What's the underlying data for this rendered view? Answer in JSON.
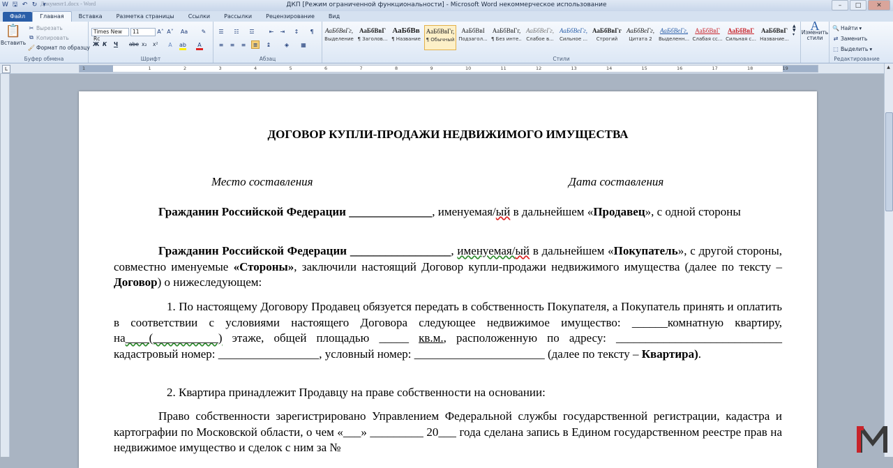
{
  "window": {
    "title": "ДКП [Режим ограниченной функциональности] - Microsoft Word некоммерческое использование",
    "doc_name_faded": "Документ1.docx - Word"
  },
  "tabs": [
    "Файл",
    "Главная",
    "Вставка",
    "Разметка страницы",
    "Ссылки",
    "Рассылки",
    "Рецензирование",
    "Вид"
  ],
  "clipboard": {
    "paste": "Вставить",
    "cut": "Вырезать",
    "copy": "Копировать",
    "format_painter": "Формат по образцу",
    "label": "Буфер обмена"
  },
  "font": {
    "name": "Times New Rc",
    "size": "11",
    "label": "Шрифт",
    "bold": "Ж",
    "italic": "К",
    "underline": "Ч",
    "strike": "abe",
    "sub": "x₂",
    "sup": "x²"
  },
  "paragraph": {
    "label": "Абзац"
  },
  "styles": {
    "label": "Стили",
    "items": [
      {
        "sample": "АаБбВвГг,",
        "name": "Выделение"
      },
      {
        "sample": "АаБбВвГ",
        "name": "¶ Заголов..."
      },
      {
        "sample": "АаБбВв",
        "name": "¶ Название"
      },
      {
        "sample": "АаБбВвГг,",
        "name": "¶ Обычный"
      },
      {
        "sample": "АаБбВвІ",
        "name": "Подзагол..."
      },
      {
        "sample": "АаБбВвГг,",
        "name": "¶ Без инте..."
      },
      {
        "sample": "АаБбВеГг,",
        "name": "Слабое в..."
      },
      {
        "sample": "АаБбВеГг,",
        "name": "Сильное ..."
      },
      {
        "sample": "АаБбВвГг",
        "name": "Строгий"
      },
      {
        "sample": "АаБбВеГг,",
        "name": "Цитата 2"
      },
      {
        "sample": "АаБбВеГг,",
        "name": "Выделенн..."
      },
      {
        "sample": "АаБбВвГ",
        "name": "Слабая сс..."
      },
      {
        "sample": "АаБбВвГ",
        "name": "Сильная с..."
      },
      {
        "sample": "АаБбВвГ",
        "name": "Название..."
      }
    ],
    "change": "Изменить стили"
  },
  "editing": {
    "find": "Найти",
    "replace": "Заменить",
    "select": "Выделить",
    "label": "Редактирование"
  },
  "ruler_numbers": [
    "1",
    "1",
    "2",
    "3",
    "4",
    "5",
    "6",
    "7",
    "8",
    "9",
    "10",
    "11",
    "12",
    "13",
    "14",
    "15",
    "16",
    "17",
    "18",
    "19"
  ],
  "document": {
    "title": "ДОГОВОР КУПЛИ-ПРОДАЖИ НЕДВИЖИМОГО ИМУЩЕСТВА",
    "place": "Место составления",
    "date": "Дата составления",
    "p1": {
      "lead": "Гражданин Российской Федерации",
      "blank": "______________",
      "mid1": ", именуемая/",
      "yj": "ый",
      "mid2": " в дальнейшем «",
      "role": "Продавец",
      "tail": "», с одной стороны"
    },
    "p2": {
      "lead": "Гражданин Российской Федерации",
      "blank": "_________________",
      "mid1": ", ",
      "named": "именуемая/",
      "yj": "ый",
      "mid2": " в дальнейшем «",
      "role": "Покупатель",
      "mid3": "», с другой стороны, совместно именуемые ",
      "parties": "«Стороны»",
      "mid4": ", заключили настоящий Договор купли-продажи недвижимого имущества (далее по тексту – ",
      "contract": "Договор",
      "tail": ") о нижеследующем:"
    },
    "p3": {
      "text1": "1. По настоящему Договору Продавец обязуется передать в собственность Покупателя, а Покупатель принять и оплатить в соответствии с условиями настоящего Договора следующее недвижимое имущество: ______комнатную квартиру, на",
      "floor_blank": "____(___________)",
      "text2": " этаже, общей площадью _____ ",
      "sqm": "кв.м.",
      "text3": ", расположенную по адресу: ____________________________ кадастровый номер: _________________, условный номер: ______________________ (далее по тексту – ",
      "flat": "Квартира)",
      "tail": "."
    },
    "p4": "2.  Квартира принадлежит Продавцу на праве собственности на основании:",
    "p5": "Право собственности зарегистрировано Управлением Федеральной службы государственной регистрации, кадастра и картографии по Московской области, о чем «___» _________ 20___ года сделана запись в Едином государственном реестре прав на недвижимое имущество и сделок с ним за №"
  },
  "colors": {
    "file_tab": "#2a5ea8",
    "logo_red": "#c8242b",
    "logo_gray": "#3a3a3a"
  }
}
